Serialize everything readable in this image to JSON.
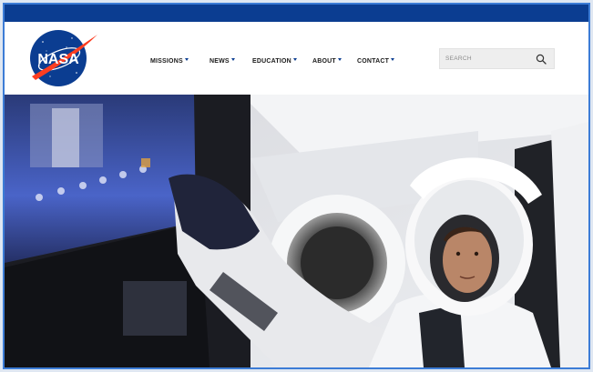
{
  "brand": {
    "logo_text": "NASA",
    "primary_color": "#0b3d91",
    "accent_color": "#fc3d21"
  },
  "nav": {
    "items": [
      {
        "label": "MISSIONS",
        "icon": "caret-down-icon"
      },
      {
        "label": "NEWS",
        "icon": "caret-down-icon"
      },
      {
        "label": "EDUCATION",
        "icon": "caret-down-icon"
      },
      {
        "label": "ABOUT",
        "icon": "caret-down-icon"
      },
      {
        "label": "CONTACT",
        "icon": "caret-down-icon"
      }
    ]
  },
  "search": {
    "placeholder": "SEARCH",
    "value": "",
    "icon": "search-icon"
  },
  "hero": {
    "image": "astronaut-in-spacecraft-cockpit"
  }
}
